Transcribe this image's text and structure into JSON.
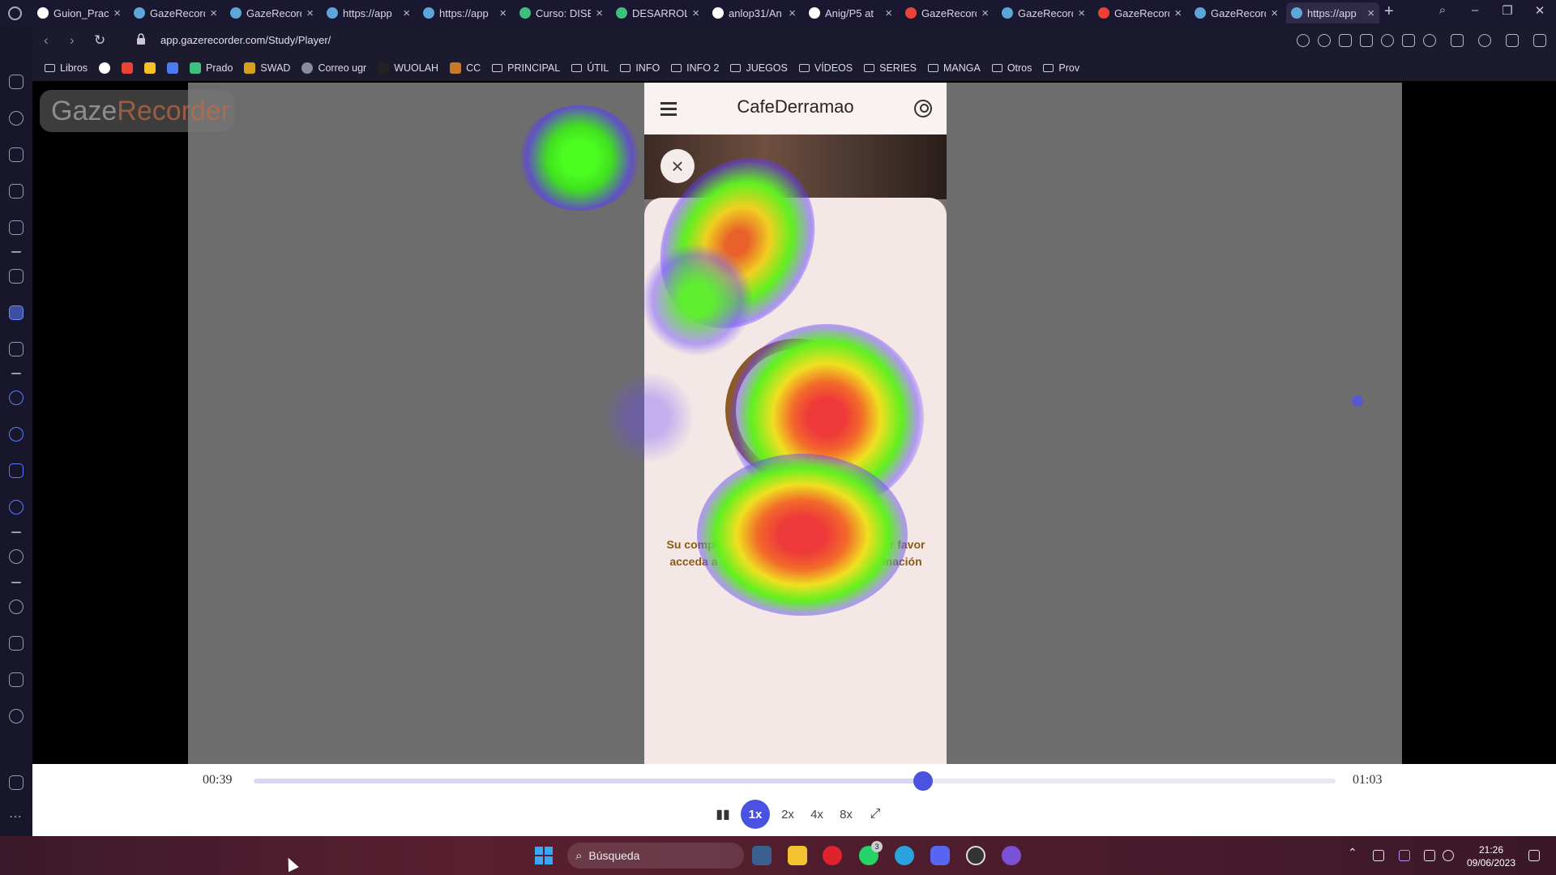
{
  "browser": {
    "tabs": [
      {
        "title": "Guion_Pract",
        "favicon": "globe-icon",
        "color": "#ffffff"
      },
      {
        "title": "GazeRecord",
        "favicon": "globe-icon",
        "color": "#5aa7d8"
      },
      {
        "title": "GazeRecord",
        "favicon": "globe-icon",
        "color": "#5aa7d8"
      },
      {
        "title": "https://app",
        "favicon": "globe-icon",
        "color": "#5aa7d8"
      },
      {
        "title": "https://app",
        "favicon": "globe-icon",
        "color": "#5aa7d8"
      },
      {
        "title": "Curso: DISE",
        "favicon": "moodle-icon",
        "color": "#3fbf7f"
      },
      {
        "title": "DESARROLL",
        "favicon": "moodle-icon",
        "color": "#3fbf7f"
      },
      {
        "title": "anlop31/An",
        "favicon": "github-icon",
        "color": "#ffffff"
      },
      {
        "title": "Anig/P5 at",
        "favicon": "github-icon",
        "color": "#ffffff"
      },
      {
        "title": "GazeRecord",
        "favicon": "gmail-icon",
        "color": "#ea4335"
      },
      {
        "title": "GazeRecord",
        "favicon": "globe-icon",
        "color": "#5aa7d8"
      },
      {
        "title": "GazeRecord",
        "favicon": "gmail-icon",
        "color": "#ea4335"
      },
      {
        "title": "GazeRecord",
        "favicon": "globe-icon",
        "color": "#5aa7d8"
      },
      {
        "title": "https://app",
        "favicon": "globe-icon",
        "color": "#5aa7d8",
        "active": true
      }
    ],
    "url": "app.gazerecorder.com/Study/Player/",
    "bookmarks": [
      {
        "label": "Libros",
        "icon": "folder-icon"
      },
      {
        "label": "",
        "icon": "google-icon"
      },
      {
        "label": "",
        "icon": "gmail-icon"
      },
      {
        "label": "",
        "icon": "drive-icon"
      },
      {
        "label": "",
        "icon": "docs-icon"
      },
      {
        "label": "Prado",
        "icon": "moodle-icon"
      },
      {
        "label": "SWAD",
        "icon": "swad-icon"
      },
      {
        "label": "Correo ugr",
        "icon": "mail-icon"
      },
      {
        "label": "WUOLAH",
        "icon": "wuolah-icon"
      },
      {
        "label": "CC",
        "icon": "cc-icon"
      },
      {
        "label": "PRINCIPAL",
        "icon": "folder-icon"
      },
      {
        "label": "ÚTIL",
        "icon": "folder-icon"
      },
      {
        "label": "INFO",
        "icon": "folder-icon"
      },
      {
        "label": "INFO 2",
        "icon": "folder-icon"
      },
      {
        "label": "JUEGOS",
        "icon": "folder-icon"
      },
      {
        "label": "VÍDEOS",
        "icon": "folder-icon"
      },
      {
        "label": "SERIES",
        "icon": "folder-icon"
      },
      {
        "label": "MANGA",
        "icon": "folder-icon"
      },
      {
        "label": "Otros",
        "icon": "folder-icon"
      },
      {
        "label": "Prov",
        "icon": "folder-icon"
      }
    ]
  },
  "player": {
    "logo_part1": "Gaze",
    "logo_part2": "Recorder",
    "current_time": "00:39",
    "total_time": "01:03",
    "progress": 0.619,
    "speeds": [
      "1x",
      "2x",
      "4x",
      "8x"
    ],
    "active_speed": "1x",
    "accent": "#4a53e0"
  },
  "app": {
    "title": "CafeDerramao",
    "message": "Su compra ha sido realizada con éxito por favor acceda a \"mis reservas\" para más información"
  },
  "taskbar": {
    "search_placeholder": "Búsqueda",
    "time": "21:26",
    "date": "09/06/2023",
    "whatsapp_badge": "3"
  }
}
